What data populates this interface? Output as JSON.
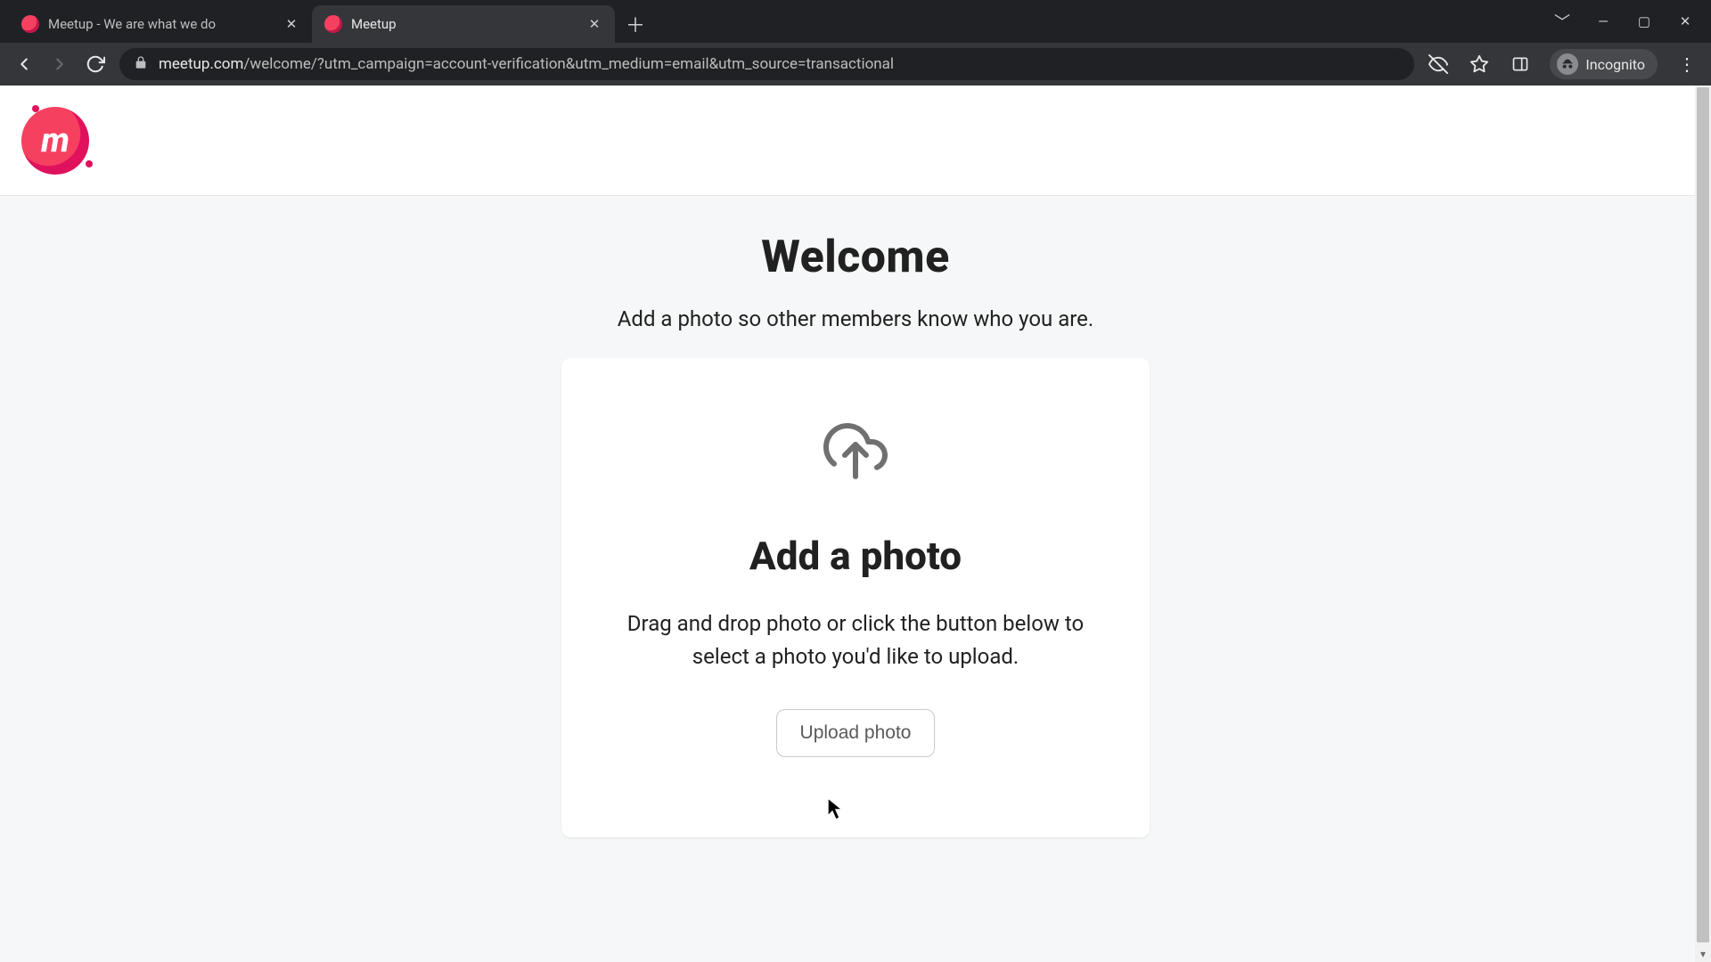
{
  "browser": {
    "tabs": [
      {
        "title": "Meetup - We are what we do",
        "active": false
      },
      {
        "title": "Meetup",
        "active": true
      }
    ],
    "url_host": "meetup.com",
    "url_path": "/welcome/?utm_campaign=account-verification&utm_medium=email&utm_source=transactional",
    "incognito_label": "Incognito"
  },
  "logo_letter": "m",
  "page": {
    "title": "Welcome",
    "subtitle": "Add a photo so other members know who you are."
  },
  "card": {
    "title": "Add a photo",
    "description": "Drag and drop photo or click the button below to select a photo you'd like to upload.",
    "button": "Upload photo"
  }
}
